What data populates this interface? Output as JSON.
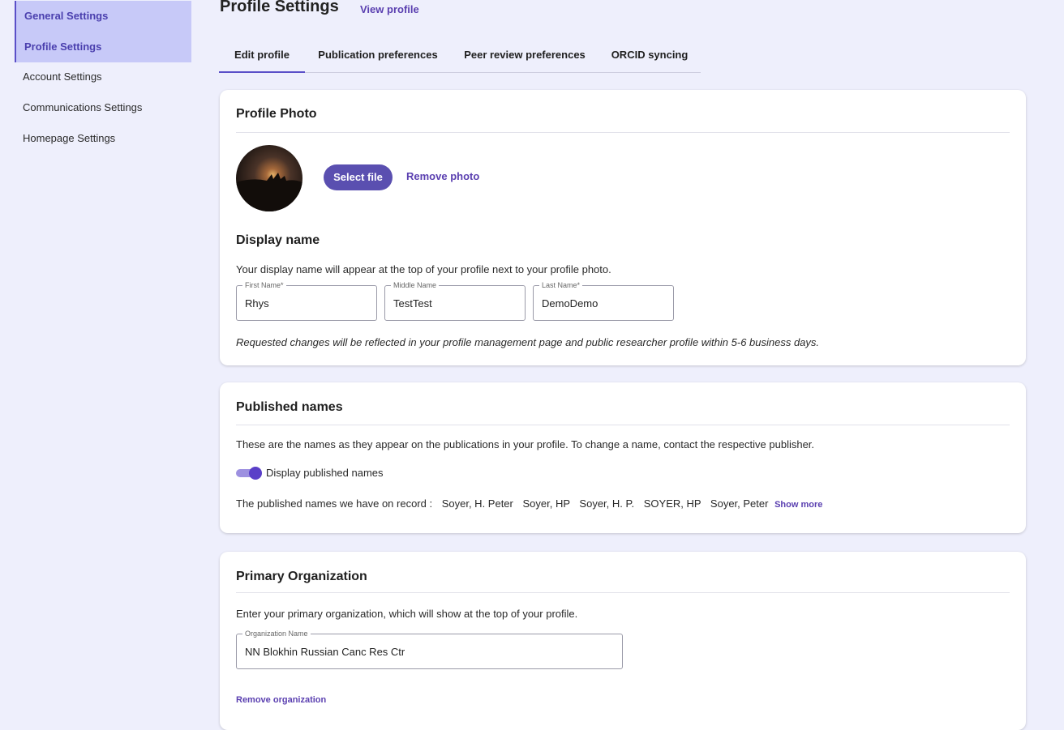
{
  "sidebar": {
    "items": [
      {
        "label": "General Settings"
      },
      {
        "label": "Profile Settings"
      },
      {
        "label": "Account Settings"
      },
      {
        "label": "Communications Settings"
      },
      {
        "label": "Homepage Settings"
      }
    ]
  },
  "header": {
    "title": "Profile Settings",
    "view_profile": "View profile"
  },
  "tabs": [
    {
      "label": "Edit profile"
    },
    {
      "label": "Publication preferences"
    },
    {
      "label": "Peer review preferences"
    },
    {
      "label": "ORCID syncing"
    }
  ],
  "profile_photo": {
    "title": "Profile Photo",
    "select_file": "Select file",
    "remove_photo": "Remove photo"
  },
  "display_name": {
    "title": "Display name",
    "description": "Your display name will appear at the top of your profile next to your profile photo.",
    "first_name_label": "First Name",
    "first_name_value": "Rhys",
    "middle_name_label": "Middle Name",
    "middle_name_value": "TestTest",
    "last_name_label": "Last Name",
    "last_name_value": "DemoDemo",
    "note": "Requested changes will be reflected in your profile management page and public researcher profile within 5-6 business days."
  },
  "published_names": {
    "title": "Published names",
    "description": "These are the names as they appear on the publications in your profile. To change a name, contact the respective publisher.",
    "toggle_label": "Display published names",
    "toggle_on": true,
    "record_label": "The published names we have on record :",
    "names": [
      "Soyer, H. Peter",
      "Soyer, HP",
      "Soyer, H. P.",
      "SOYER, HP",
      "Soyer, Peter"
    ],
    "show_more": "Show more"
  },
  "primary_org": {
    "title": "Primary Organization",
    "description": "Enter your primary organization, which will show at the top of your profile.",
    "org_label": "Organization Name",
    "org_value": "NN Blokhin Russian Canc Res Ctr",
    "remove": "Remove organization"
  },
  "colors": {
    "accent": "#5a4fb0",
    "background": "#eeeffc",
    "sidebar_active": "#c7c9f8"
  }
}
